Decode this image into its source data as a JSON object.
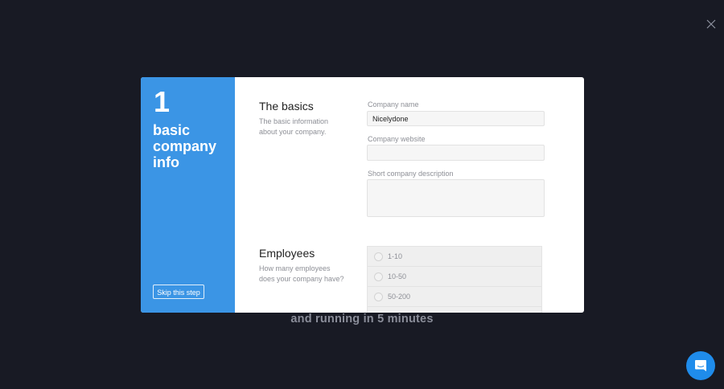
{
  "background": {
    "tagline": "and running in 5 minutes",
    "close_icon": "close-icon"
  },
  "step": {
    "number": "1",
    "title": "basic company info",
    "skip_label": "Skip this step"
  },
  "sections": {
    "basics": {
      "title": "The basics",
      "description": "The basic information about your company."
    },
    "employees": {
      "title": "Employees",
      "description": "How many employees does your company have?"
    }
  },
  "fields": {
    "company_name": {
      "label": "Company name",
      "value": "Nicelydone"
    },
    "company_website": {
      "label": "Company website",
      "value": ""
    },
    "short_description": {
      "label": "Short company description",
      "value": ""
    }
  },
  "employee_options": [
    "1-10",
    "10-50",
    "50-200"
  ],
  "chat": {
    "icon": "chat-icon"
  },
  "colors": {
    "sidebar": "#3b95e5",
    "background": "#181a24",
    "chat_button": "#1f8ceb"
  }
}
